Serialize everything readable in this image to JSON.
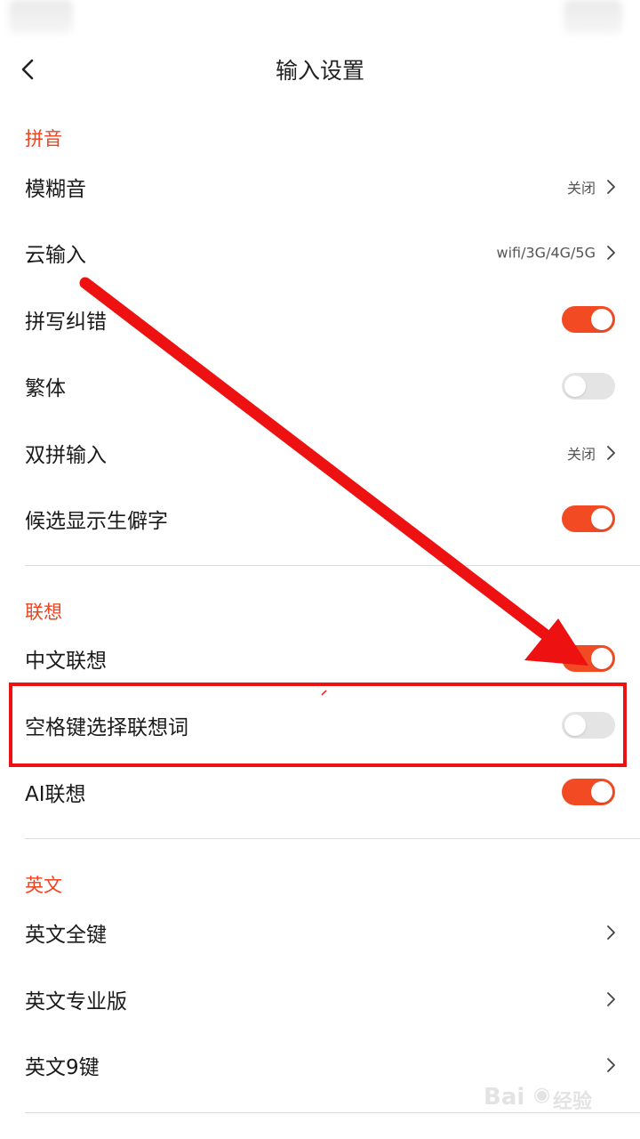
{
  "header": {
    "title": "输入设置"
  },
  "sections": {
    "pinyin": {
      "title": "拼音"
    },
    "association": {
      "title": "联想"
    },
    "english": {
      "title": "英文"
    }
  },
  "pinyin_rows": [
    {
      "label": "模糊音",
      "value": "关闭",
      "type": "link"
    },
    {
      "label": "云输入",
      "value": "wifi/3G/4G/5G",
      "type": "link"
    },
    {
      "label": "拼写纠错",
      "type": "toggle",
      "on": true
    },
    {
      "label": "繁体",
      "type": "toggle",
      "on": false
    },
    {
      "label": "双拼输入",
      "value": "关闭",
      "type": "link"
    },
    {
      "label": "候选显示生僻字",
      "type": "toggle",
      "on": true
    }
  ],
  "association_rows": [
    {
      "label": "中文联想",
      "type": "toggle",
      "on": true
    },
    {
      "label": "空格键选择联想词",
      "type": "toggle",
      "on": false
    },
    {
      "label": "AI联想",
      "type": "toggle",
      "on": true
    }
  ],
  "english_rows": [
    {
      "label": "英文全键",
      "type": "link"
    },
    {
      "label": "英文专业版",
      "type": "link"
    },
    {
      "label": "英文9键",
      "type": "link"
    }
  ],
  "colors": {
    "accent": "#f24b24",
    "section_title": "#f0431f",
    "annotation": "#ee1111"
  }
}
